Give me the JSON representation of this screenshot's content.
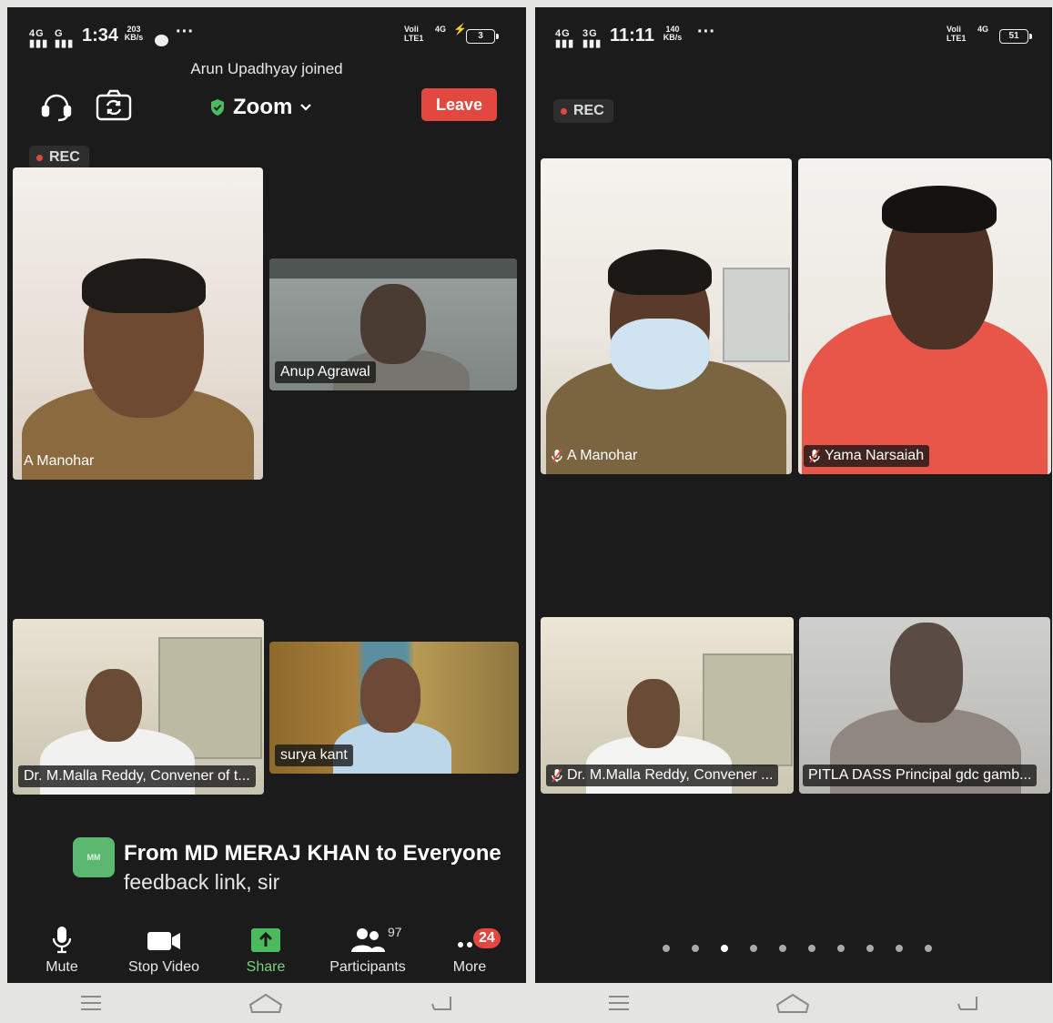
{
  "left": {
    "status": {
      "net1": "4G",
      "net2": "G",
      "time": "1:34",
      "speed": "203",
      "speed_unit": "KB/s",
      "more": "···",
      "volte": "Voli",
      "lte": "LTE1",
      "net3": "4G",
      "battery": "3"
    },
    "toast": "Arun Upadhyay joined",
    "meeting_title": "Zoom",
    "leave_label": "Leave",
    "rec_label": "REC",
    "tiles": [
      {
        "name": "A Manohar"
      },
      {
        "name": "Anup Agrawal"
      },
      {
        "name": "Dr. M.Malla Reddy, Convener of t..."
      },
      {
        "name": "surya kant"
      }
    ],
    "chat": {
      "avatar_initials": "MM",
      "sender": "From MD MERAJ KHAN to Everyone",
      "message": "feedback link, sir"
    },
    "toolbar": {
      "mute": "Mute",
      "stop_video": "Stop Video",
      "share": "Share",
      "participants": "Participants",
      "participants_count": "97",
      "more": "More",
      "more_badge": "24"
    }
  },
  "right": {
    "status": {
      "net1": "4G",
      "net2": "3G",
      "time": "11:11",
      "speed": "140",
      "speed_unit": "KB/s",
      "more": "···",
      "volte": "Voli",
      "lte": "LTE1",
      "net3": "4G",
      "battery": "51"
    },
    "rec_label": "REC",
    "tiles": [
      {
        "name": "A Manohar"
      },
      {
        "name": "Yama Narsaiah"
      },
      {
        "name": "Dr. M.Malla Reddy, Convener ..."
      },
      {
        "name": "PITLA DASS Principal gdc gamb..."
      }
    ],
    "pager": {
      "pages": 10,
      "active": 2
    }
  },
  "colors": {
    "accent_red": "#e2483f",
    "share_green": "#5bb870",
    "background": "#1b1b1b"
  },
  "icons": [
    "headset-icon",
    "camera-switch-icon",
    "shield-check-icon",
    "chevron-down-icon",
    "mic-icon",
    "video-icon",
    "share-icon",
    "participants-icon",
    "more-icon",
    "mic-off-icon",
    "menu-icon",
    "home-icon",
    "back-icon"
  ]
}
